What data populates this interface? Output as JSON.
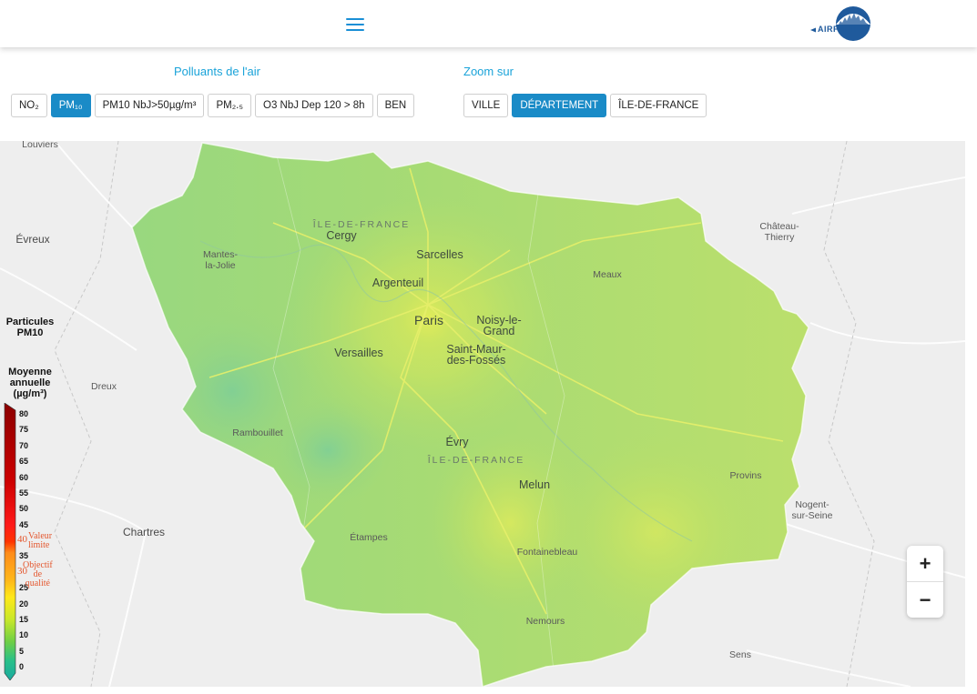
{
  "header": {
    "logo_text": "AIRPARIF"
  },
  "pollutants": {
    "title": "Polluants de l'air",
    "buttons": [
      {
        "label": "NO₂",
        "active": false
      },
      {
        "label": "PM₁₀",
        "active": true
      },
      {
        "label": "PM10 NbJ>50µg/m³",
        "active": false
      },
      {
        "label": "PM₂.₅",
        "active": false
      },
      {
        "label": "O3 NbJ Dep 120 > 8h",
        "active": false
      },
      {
        "label": "BEN",
        "active": false
      }
    ]
  },
  "zoom_sur": {
    "title": "Zoom sur",
    "buttons": [
      {
        "label": "VILLE",
        "active": false
      },
      {
        "label": "DÉPARTEMENT",
        "active": true
      },
      {
        "label": "ÎLE-DE-FRANCE",
        "active": false
      }
    ]
  },
  "map": {
    "labels": {
      "louviers": "Louviers",
      "evreux": "Évreux",
      "dreux": "Dreux",
      "chartres": "Chartres",
      "chateau_thierry": "Château-\nThierry",
      "nogent": "Nogent-\nsur-Seine",
      "sens": "Sens",
      "cergy": "Cergy",
      "mantes": "Mantes-\nla-Jolie",
      "sarcelles": "Sarcelles",
      "argenteuil": "Argenteuil",
      "paris": "Paris",
      "noisy": "Noisy-le-\nGrand",
      "saint_maur": "Saint-Maur-\ndes-Fossés",
      "versailles": "Versailles",
      "meaux": "Meaux",
      "rambouillet": "Rambouillet",
      "evry": "Évry",
      "melun": "Melun",
      "etampes": "Étampes",
      "fontainebleau": "Fontainebleau",
      "provins": "Provins",
      "nemours": "Nemours",
      "region_north": "ÎLE-DE-FRANCE",
      "region_south": "ÎLE-DE-FRANCE"
    },
    "zoom_in": "+",
    "zoom_out": "−"
  },
  "legend": {
    "title": "Particules\nPM10",
    "subtitle": "Moyenne\nannuelle\n(µg/m³)",
    "ticks": [
      "80",
      "75",
      "70",
      "65",
      "60",
      "55",
      "50",
      "45",
      "40",
      "35",
      "30",
      "25",
      "20",
      "15",
      "10",
      "5",
      "0"
    ],
    "valeur_limite": "Valeur\nlimite",
    "objectif_qualite": "Objectif\nde\nqualité",
    "colors": [
      "#8b0000",
      "#cc0000",
      "#ff1a1a",
      "#ff8c1a",
      "#ffe01a",
      "#c9e82a",
      "#8ad43a",
      "#3ec27a",
      "#1fb59a"
    ]
  }
}
